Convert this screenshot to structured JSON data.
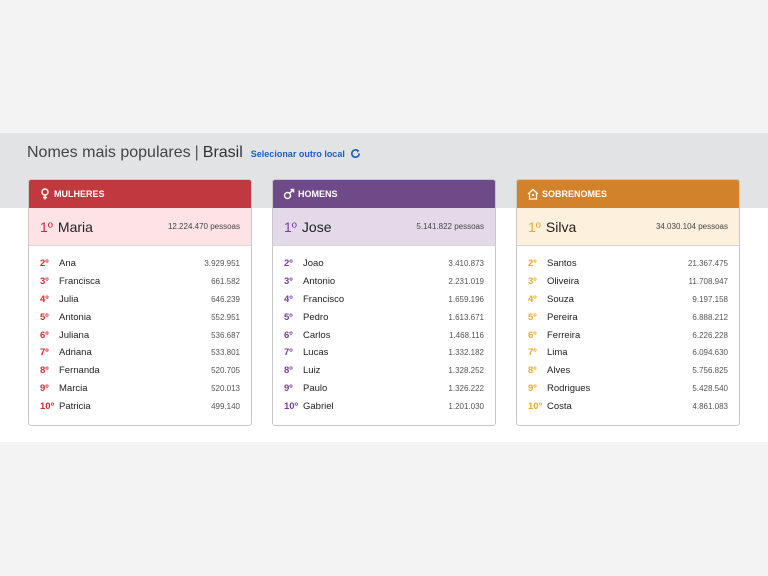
{
  "header": {
    "title": "Nomes mais populares",
    "separator": "|",
    "location": "Brasil",
    "change_location": "Selecionar outro local",
    "link_color": "#1f5fbf"
  },
  "cards": [
    {
      "icon": "female-icon",
      "label": "MULHERES",
      "color": "#c0393f",
      "top": {
        "rank": "1º",
        "name": "Maria",
        "value": "12.224.470 pessoas"
      },
      "items": [
        {
          "rank": "2º",
          "name": "Ana",
          "value": "3.929.951"
        },
        {
          "rank": "3º",
          "name": "Francisca",
          "value": "661.582"
        },
        {
          "rank": "4º",
          "name": "Julia",
          "value": "646.239"
        },
        {
          "rank": "5º",
          "name": "Antonia",
          "value": "552.951"
        },
        {
          "rank": "6º",
          "name": "Juliana",
          "value": "536.687"
        },
        {
          "rank": "7º",
          "name": "Adriana",
          "value": "533.801"
        },
        {
          "rank": "8º",
          "name": "Fernanda",
          "value": "520.705"
        },
        {
          "rank": "9º",
          "name": "Marcia",
          "value": "520.013"
        },
        {
          "rank": "10º",
          "name": "Patricia",
          "value": "499.140"
        }
      ]
    },
    {
      "icon": "male-icon",
      "label": "HOMENS",
      "color": "#6f4a89",
      "top": {
        "rank": "1º",
        "name": "Jose",
        "value": "5.141.822 pessoas"
      },
      "items": [
        {
          "rank": "2º",
          "name": "Joao",
          "value": "3.410.873"
        },
        {
          "rank": "3º",
          "name": "Antonio",
          "value": "2.231.019"
        },
        {
          "rank": "4º",
          "name": "Francisco",
          "value": "1.659.196"
        },
        {
          "rank": "5º",
          "name": "Pedro",
          "value": "1.613.671"
        },
        {
          "rank": "6º",
          "name": "Carlos",
          "value": "1.468.116"
        },
        {
          "rank": "7º",
          "name": "Lucas",
          "value": "1.332.182"
        },
        {
          "rank": "8º",
          "name": "Luiz",
          "value": "1.328.252"
        },
        {
          "rank": "9º",
          "name": "Paulo",
          "value": "1.326.222"
        },
        {
          "rank": "10º",
          "name": "Gabriel",
          "value": "1.201.030"
        }
      ]
    },
    {
      "icon": "family-icon",
      "label": "SOBRENOMES",
      "color": "#d1822a",
      "top": {
        "rank": "1º",
        "name": "Silva",
        "value": "34.030.104 pessoas"
      },
      "items": [
        {
          "rank": "2º",
          "name": "Santos",
          "value": "21.367.475"
        },
        {
          "rank": "3º",
          "name": "Oliveira",
          "value": "11.708.947"
        },
        {
          "rank": "4º",
          "name": "Souza",
          "value": "9.197.158"
        },
        {
          "rank": "5º",
          "name": "Pereira",
          "value": "6.888.212"
        },
        {
          "rank": "6º",
          "name": "Ferreira",
          "value": "6.226.228"
        },
        {
          "rank": "7º",
          "name": "Lima",
          "value": "6.094.630"
        },
        {
          "rank": "8º",
          "name": "Alves",
          "value": "5.756.825"
        },
        {
          "rank": "9º",
          "name": "Rodrigues",
          "value": "5.428.540"
        },
        {
          "rank": "10º",
          "name": "Costa",
          "value": "4.861.083"
        }
      ]
    }
  ]
}
